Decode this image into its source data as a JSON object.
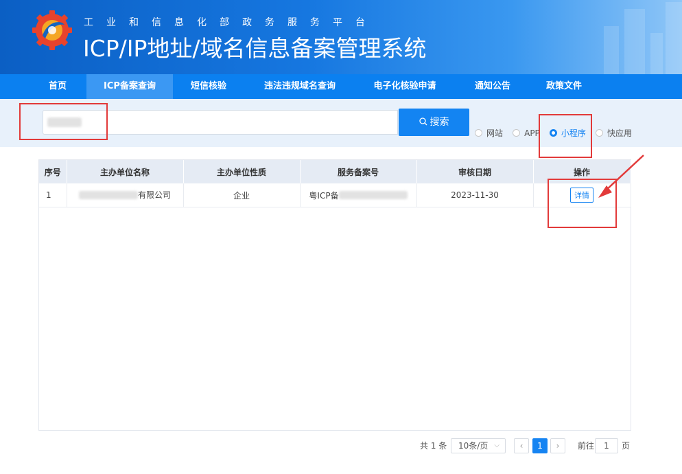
{
  "header": {
    "subtitle": "工业和信息化部政务服务平台",
    "title": "ICP/IP地址/域名信息备案管理系统"
  },
  "nav": {
    "items": [
      {
        "label": "首页",
        "active": false
      },
      {
        "label": "ICP备案查询",
        "active": true
      },
      {
        "label": "短信核验",
        "active": false
      },
      {
        "label": "违法违规域名查询",
        "active": false
      },
      {
        "label": "电子化核验申请",
        "active": false
      },
      {
        "label": "通知公告",
        "active": false
      },
      {
        "label": "政策文件",
        "active": false
      }
    ]
  },
  "search": {
    "button_label": "搜索",
    "types": [
      {
        "label": "网站",
        "checked": false
      },
      {
        "label": "APP",
        "checked": false
      },
      {
        "label": "小程序",
        "checked": true
      },
      {
        "label": "快应用",
        "checked": false
      }
    ]
  },
  "table": {
    "headers": [
      "序号",
      "主办单位名称",
      "主办单位性质",
      "服务备案号",
      "审核日期",
      "操作"
    ],
    "rows": [
      {
        "index": "1",
        "org_name_suffix": "有限公司",
        "org_type": "企业",
        "record_prefix": "粤ICP备",
        "review_date": "2023-11-30",
        "action": "详情"
      }
    ]
  },
  "pagination": {
    "total": "共 1 条",
    "page_size": "10条/页",
    "current_page": "1",
    "goto_label": "前往",
    "goto_value": "1",
    "page_unit": "页"
  },
  "colors": {
    "primary": "#1684f2",
    "nav_bg": "#0b80f0",
    "annotation": "#e23a3a"
  }
}
